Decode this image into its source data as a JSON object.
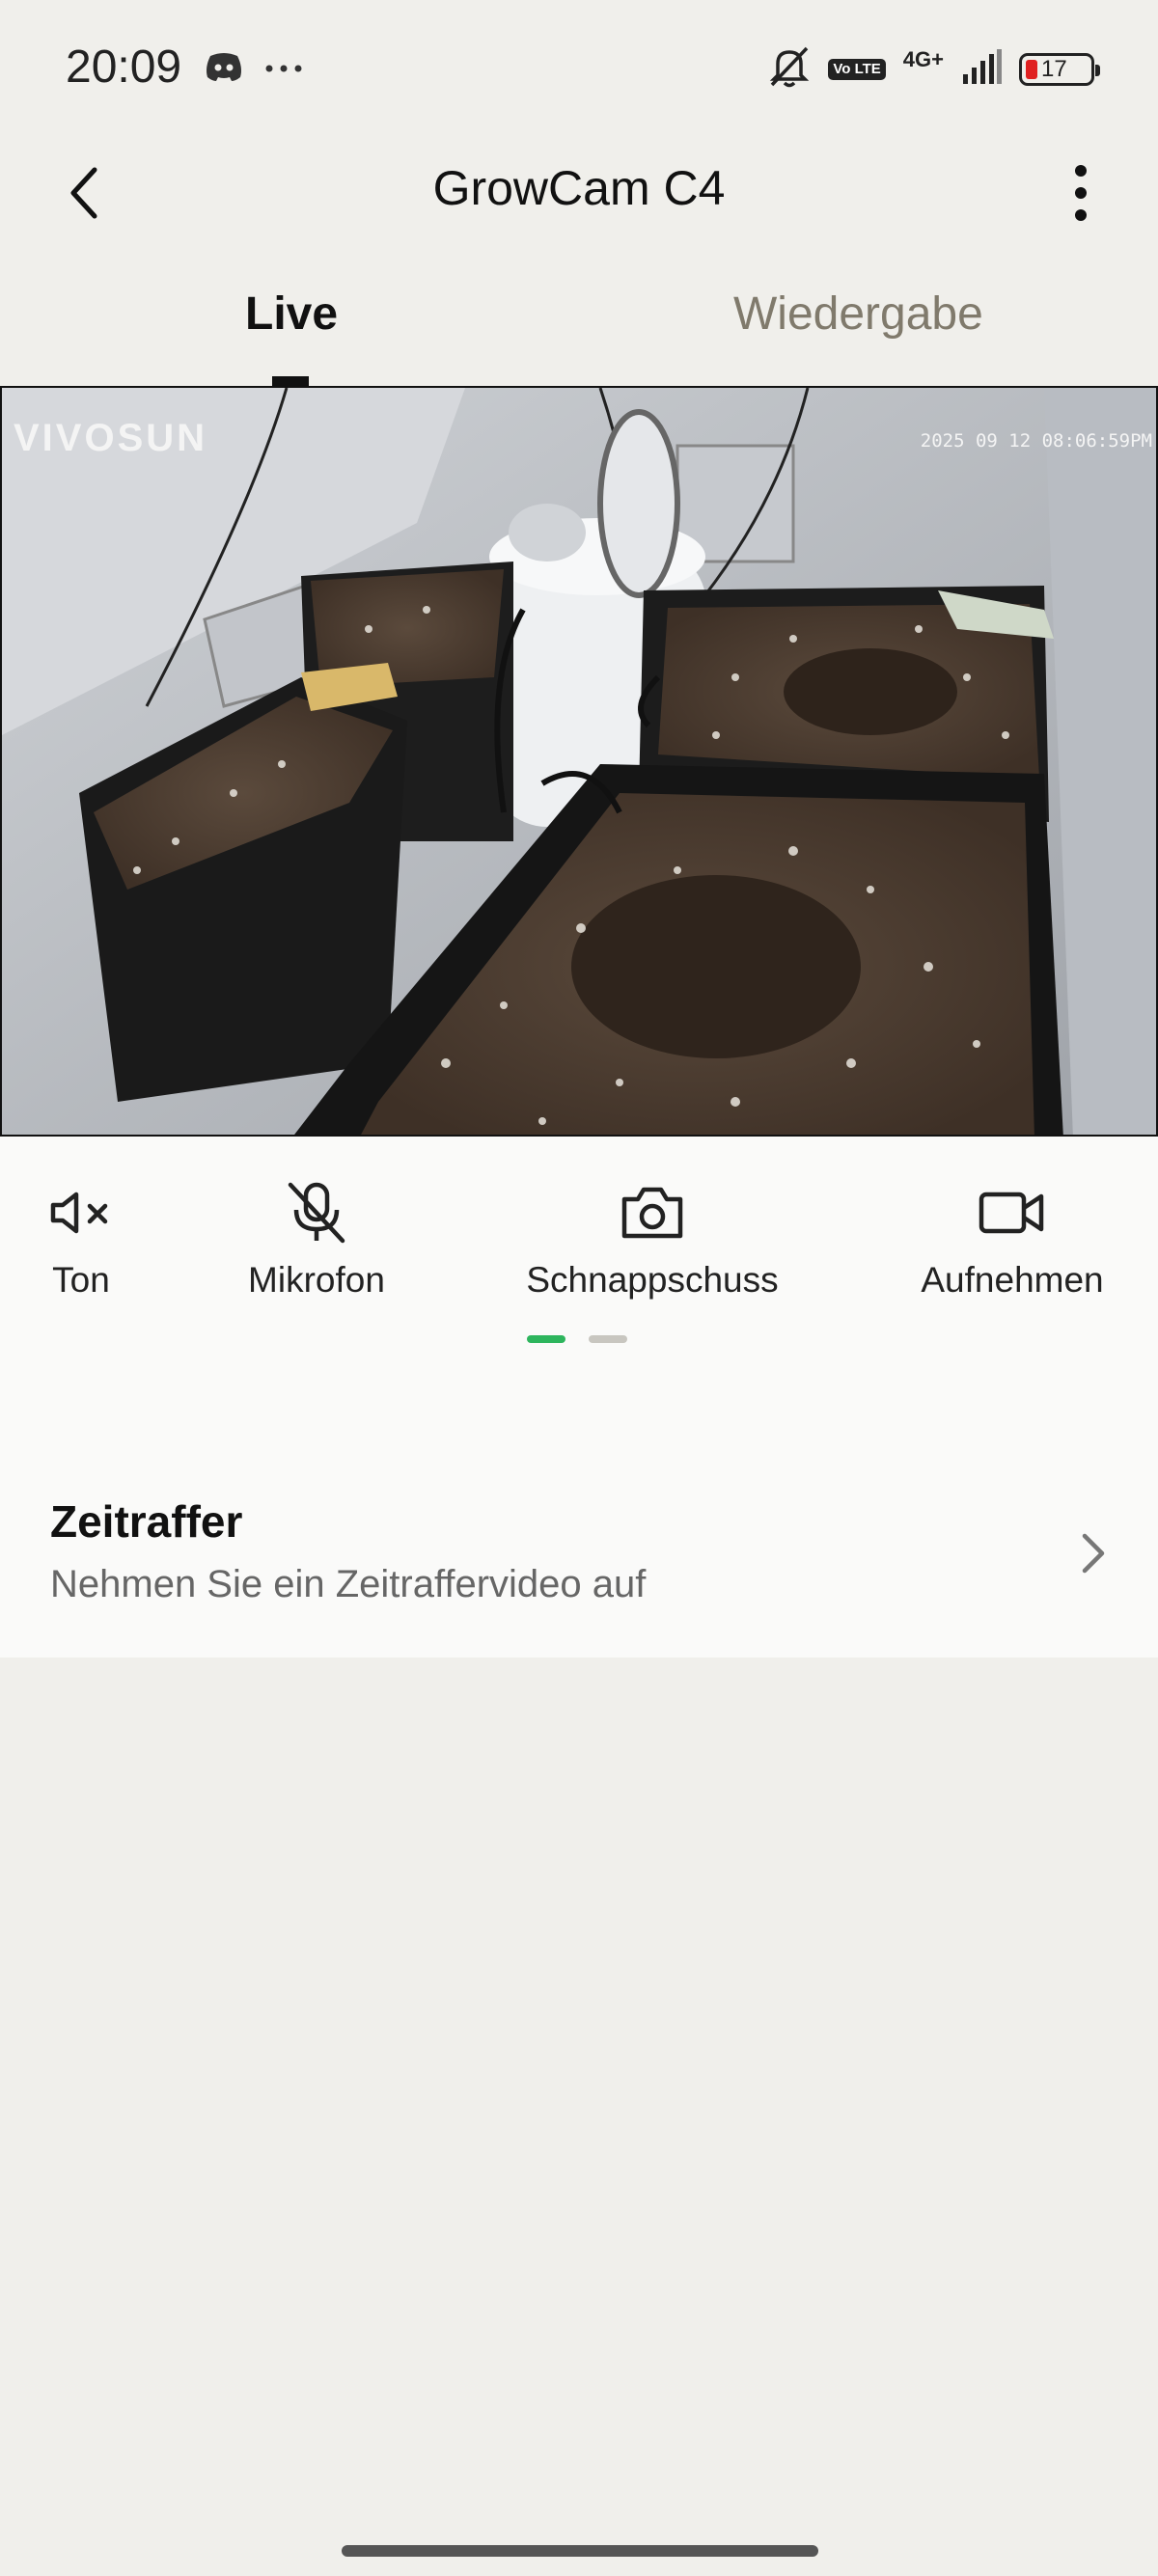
{
  "status_bar": {
    "time": "20:09",
    "icons_left": [
      "discord-icon",
      "more-dots-icon"
    ],
    "icons_right": [
      "bell-off-icon",
      "volte-icon",
      "signal-icon",
      "battery-icon"
    ],
    "volte_label": "Vo LTE",
    "network_type": "4G+",
    "battery_percent": "17",
    "battery_color": "#e02020"
  },
  "header": {
    "title": "GrowCam C4",
    "back_icon": "chevron-left-icon",
    "menu_icon": "kebab-menu-icon"
  },
  "tabs": {
    "items": [
      {
        "label": "Live",
        "active": true
      },
      {
        "label": "Wiedergabe",
        "active": false
      }
    ]
  },
  "video": {
    "brand": "VIVOSUN",
    "timestamp": "2025 09 12 08:06:59PM"
  },
  "controls": {
    "items": [
      {
        "label": "Ton",
        "icon": "speaker-muted-icon"
      },
      {
        "label": "Mikrofon",
        "icon": "mic-off-icon"
      },
      {
        "label": "Schnappschuss",
        "icon": "camera-icon"
      },
      {
        "label": "Aufnehmen",
        "icon": "video-camera-icon"
      }
    ],
    "pager": {
      "pages": 2,
      "active_index": 0,
      "active_color": "#2db55d",
      "inactive_color": "#c8c6c0"
    }
  },
  "timelapse": {
    "title": "Zeitraffer",
    "subtitle": "Nehmen Sie ein Zeitraffervideo auf",
    "icon": "chevron-right-icon"
  },
  "colors": {
    "background": "#f0efeb",
    "panel": "#fafaf9",
    "inactive_tab": "#807a6c"
  }
}
